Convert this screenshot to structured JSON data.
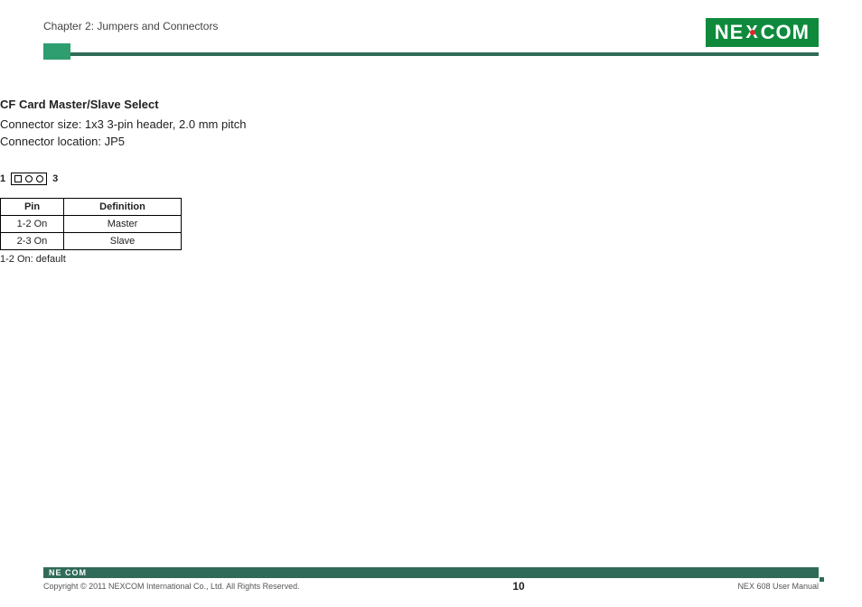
{
  "header": {
    "chapter": "Chapter 2: Jumpers and Connectors",
    "logo_pre": "NE",
    "logo_x": "X",
    "logo_post": "COM"
  },
  "section": {
    "title": "CF Card Master/Slave Select",
    "line1": "Connector size:  1x3 3-pin header, 2.0 mm pitch",
    "line2": "Connector location: JP5"
  },
  "pin_diagram": {
    "left_label": "1",
    "right_label": "3"
  },
  "table": {
    "headers": {
      "pin": "Pin",
      "def": "Definition"
    },
    "rows": [
      {
        "pin": "1-2 On",
        "def": "Master"
      },
      {
        "pin": "2-3 On",
        "def": "Slave"
      }
    ],
    "note": "1-2 On: default"
  },
  "footer": {
    "mini_logo": "NE COM",
    "copyright": "Copyright © 2011 NEXCOM International Co., Ltd. All Rights Reserved.",
    "page": "10",
    "doc": "NEX 608 User Manual"
  }
}
